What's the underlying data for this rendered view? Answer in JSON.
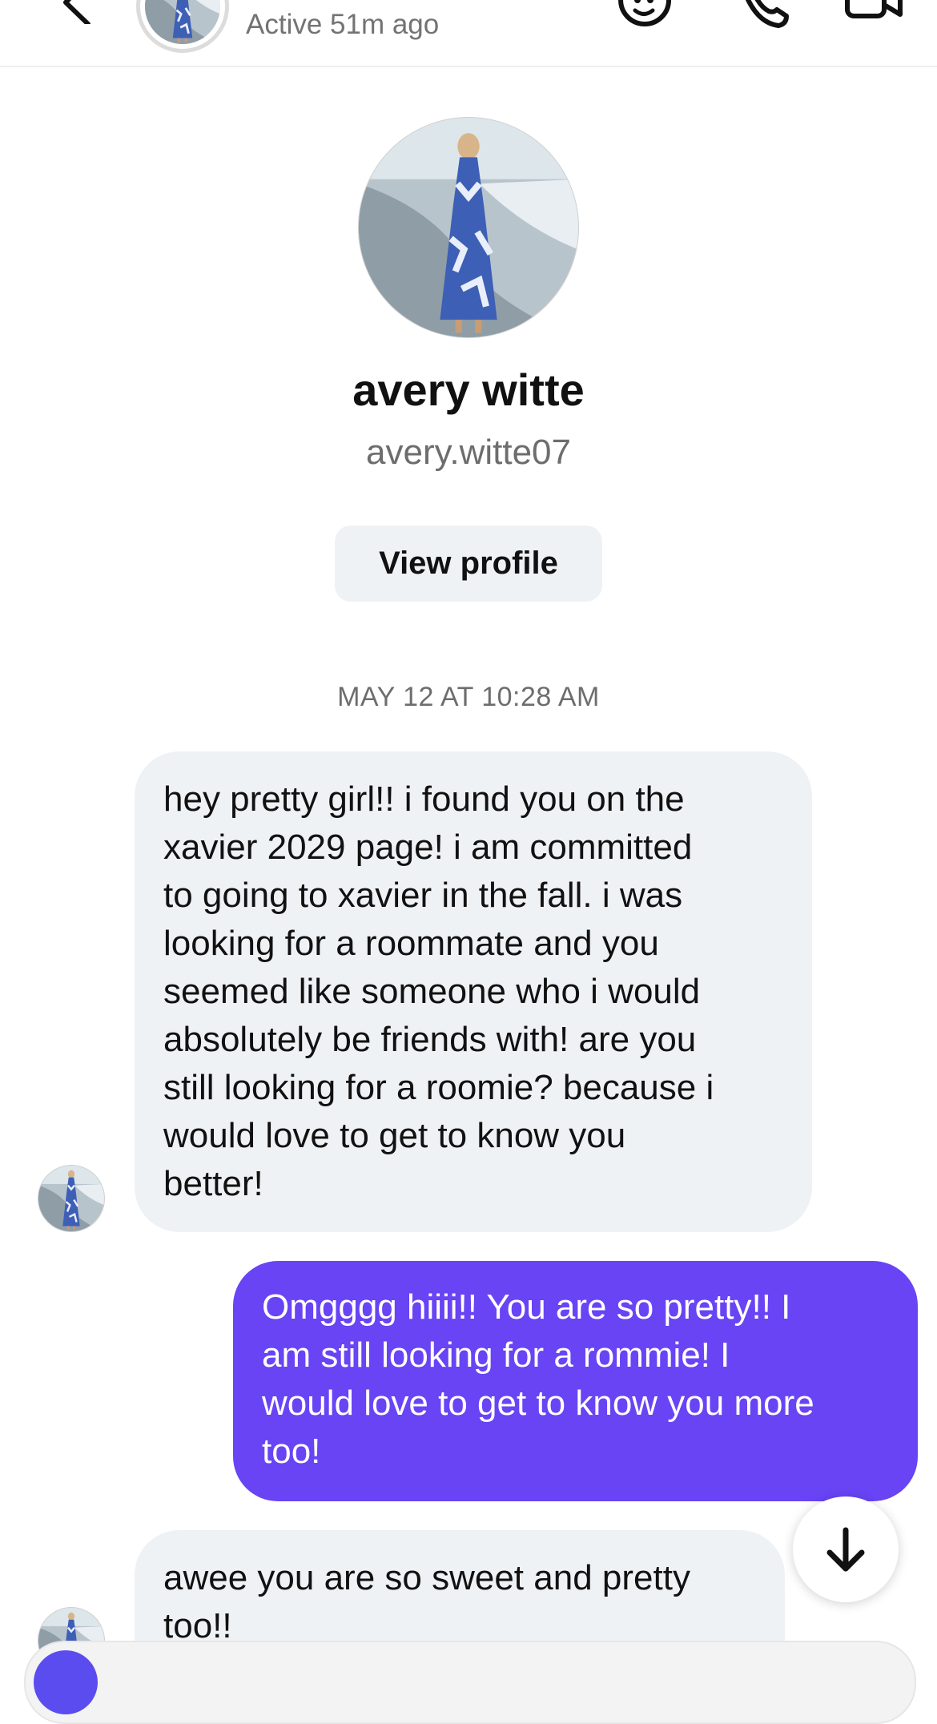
{
  "header": {
    "status": "Active 51m ago",
    "icons": [
      "back-chevron-icon",
      "sticker-icon",
      "phone-icon",
      "video-camera-icon"
    ]
  },
  "profile": {
    "name": "avery witte",
    "username": "avery.witte07",
    "view_profile_label": "View profile"
  },
  "conversation": {
    "timestamp": "MAY 12 AT 10:28 AM",
    "messages": [
      {
        "direction": "incoming",
        "lines": [
          "hey pretty girl!! i found you on the",
          "xavier 2029 page! i am committed",
          "to going to xavier in the fall. i was",
          "looking for a roommate and you",
          "seemed like someone who i would",
          "absolutely be friends with! are you",
          "still looking for a roomie? because i",
          "would love to get to know you",
          "better!"
        ]
      },
      {
        "direction": "outgoing",
        "lines": [
          "Omgggg hiiii!! You are so pretty!! I",
          "am still looking for a rommie! I",
          "would love to get to know you more",
          "too!"
        ]
      },
      {
        "direction": "incoming",
        "lines": [
          "awee you are so sweet and pretty",
          "too!!"
        ]
      }
    ]
  },
  "colors": {
    "outgoing_bubble": "#6844f5",
    "incoming_bubble": "#eff2f4",
    "secondary_text": "#6d6d6d"
  }
}
